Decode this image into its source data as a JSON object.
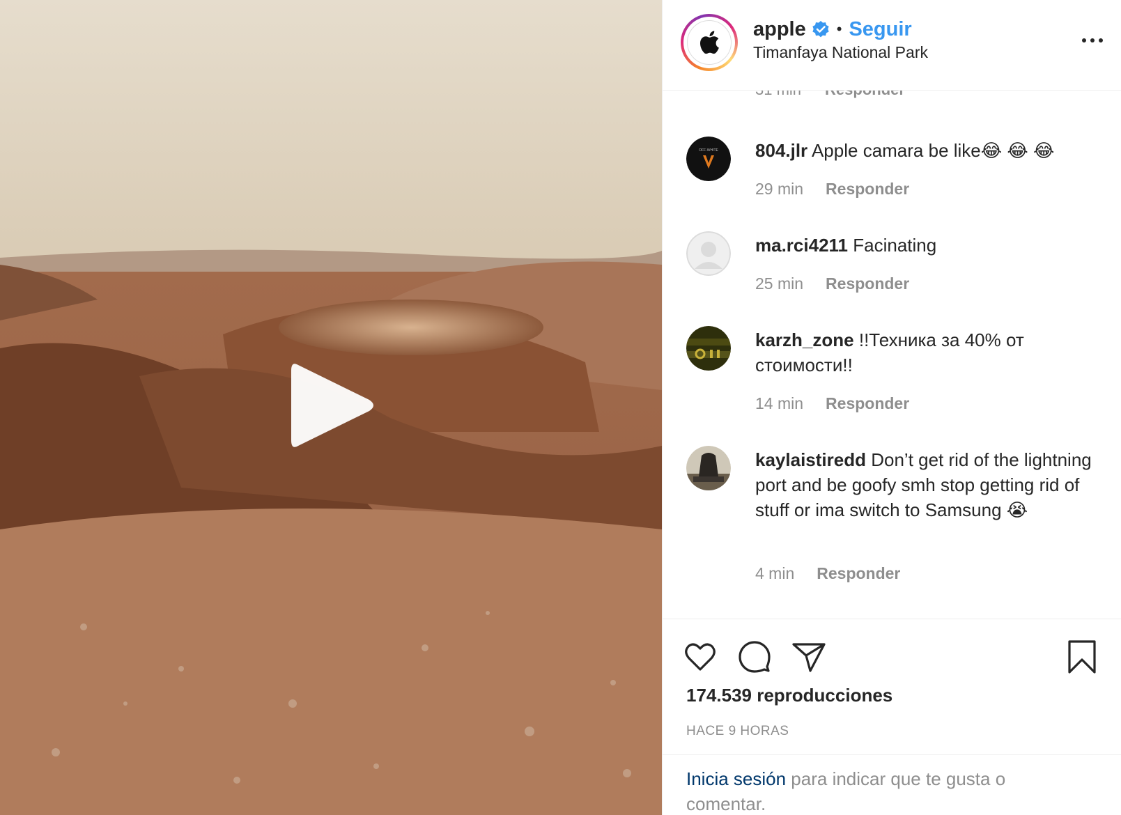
{
  "post": {
    "username": "apple",
    "follow_label": "Seguir",
    "separator": "•",
    "location": "Timanfaya National Park"
  },
  "partial_comment": {
    "time": "31 min",
    "reply_label": "Responder"
  },
  "comments": [
    {
      "user": "804.jlr",
      "text": "Apple camara be like😂 😂 😂",
      "time": "29 min",
      "reply_label": "Responder",
      "avatar_color": "#111111"
    },
    {
      "user": "ma.rci4211",
      "text": "Facinating",
      "time": "25 min",
      "reply_label": "Responder",
      "avatar_color": "#dbdbdb"
    },
    {
      "user": "karzh_zone",
      "text": "!!Техника за 40% от стоимости!!",
      "time": "14 min",
      "reply_label": "Responder",
      "avatar_color": "#3a3a10"
    },
    {
      "user": "kaylaistiredd",
      "text": "Don’t get rid of the lightning port and be goofy smh stop getting rid of stuff or ima switch to Samsung 😭",
      "time": "4 min",
      "reply_label": "Responder",
      "avatar_color": "#8a8070"
    }
  ],
  "actions": {
    "like_icon": "heart-icon",
    "comment_icon": "comment-icon",
    "share_icon": "paper-plane-icon",
    "save_icon": "bookmark-icon"
  },
  "views_text": "174.539 reproducciones",
  "time_ago": "HACE 9 HORAS",
  "login": {
    "link_text": "Inicia sesión",
    "rest_text": " para indicar que te gusta o comentar."
  },
  "colors": {
    "accent": "#3897f0",
    "muted": "#8e8e8e",
    "text": "#262626",
    "link_dark": "#00376b"
  }
}
